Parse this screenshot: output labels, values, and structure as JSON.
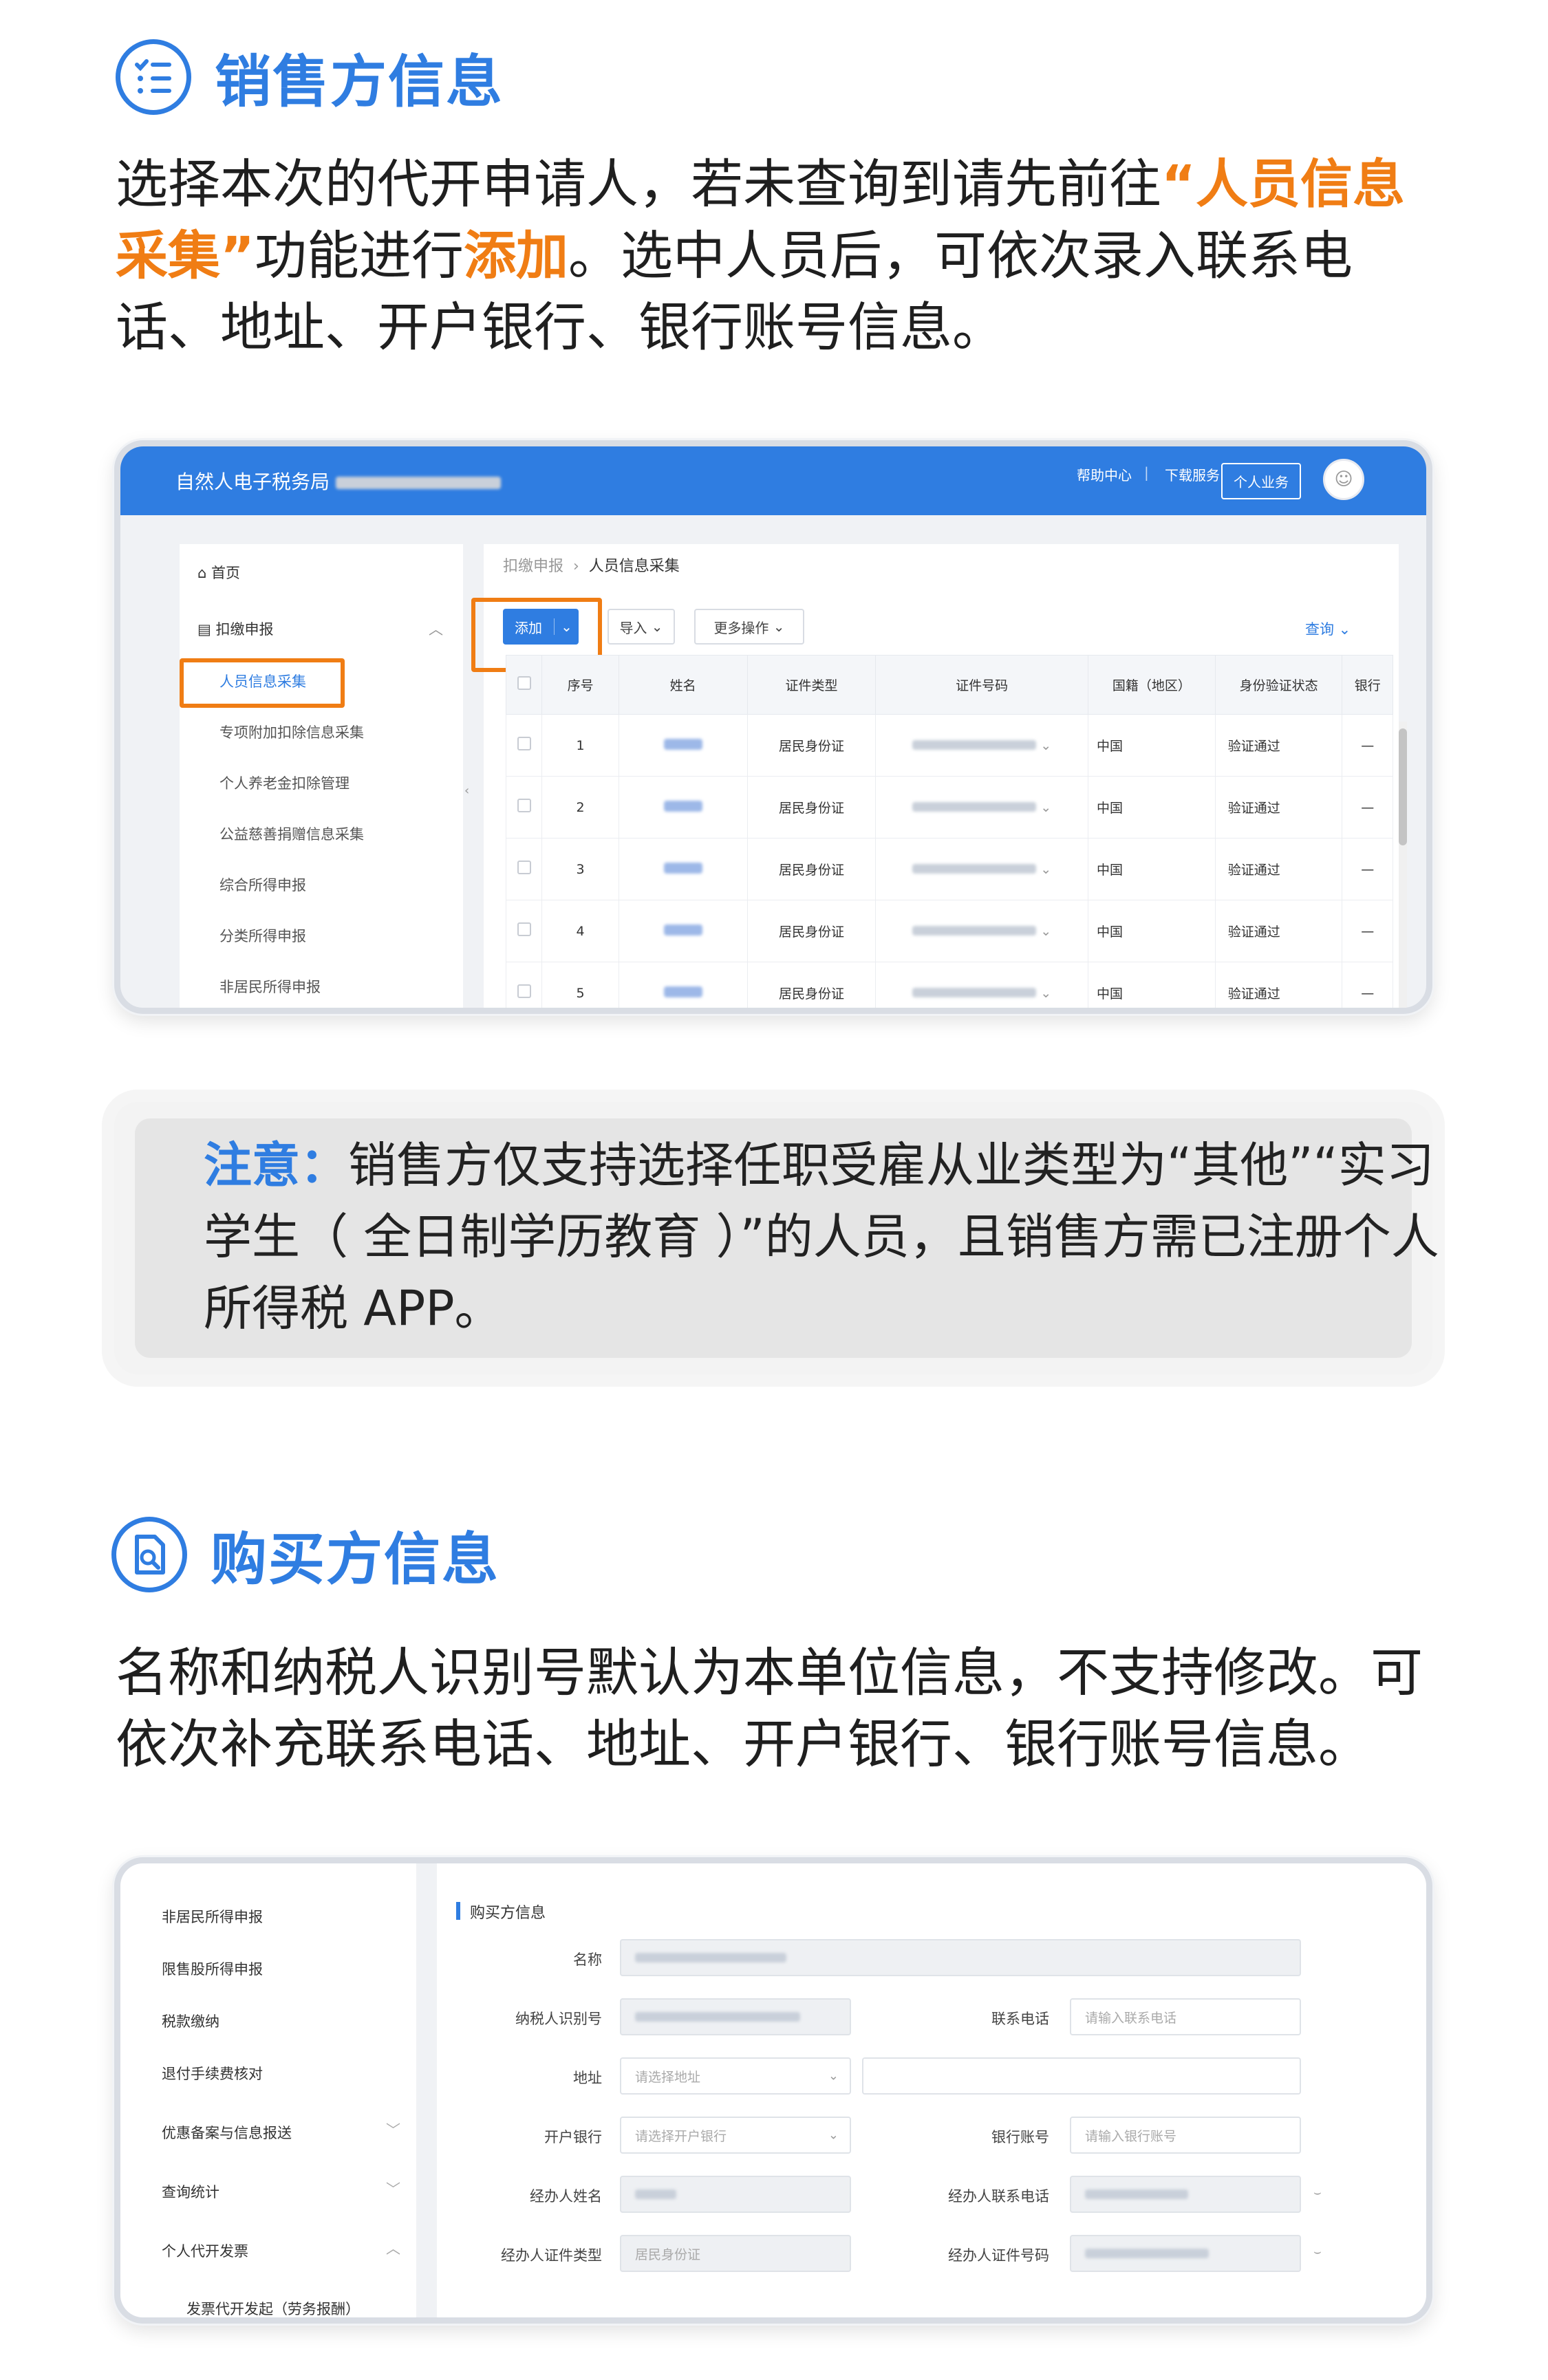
{
  "seller_section": {
    "title": "销售方信息",
    "para_line1": "选择本次的代开申请人，若未查询到请先前往",
    "para_hl1": "“人员信息采集”",
    "para_mid": "功能进行",
    "para_hl2": "添加",
    "para_rest": "。选中人员后，可依次录入联系电话、地址、开户银行、银行账号信息。"
  },
  "screenshot1": {
    "brand": "自然人电子税务局",
    "help": "帮助中心",
    "download": "下载服务",
    "personal_btn": "个人业务",
    "nav": {
      "home": "首页",
      "withholding": "扣缴申报",
      "items": [
        "人员信息采集",
        "专项附加扣除信息采集",
        "个人养老金扣除管理",
        "公益慈善捐赠信息采集",
        "综合所得申报",
        "分类所得申报",
        "非居民所得申报"
      ]
    },
    "breadcrumb_parent": "扣缴申报",
    "breadcrumb_current": "人员信息采集",
    "add_btn": "添加",
    "import_btn": "导入",
    "more_btn": "更多操作",
    "query": "查询",
    "columns": [
      "序号",
      "姓名",
      "证件类型",
      "证件号码",
      "国籍（地区）",
      "身份验证状态",
      "银行"
    ],
    "rows": [
      {
        "no": "1",
        "type": "居民身份证",
        "nation": "中国",
        "status": "验证通过",
        "bank": "—"
      },
      {
        "no": "2",
        "type": "居民身份证",
        "nation": "中国",
        "status": "验证通过",
        "bank": "—"
      },
      {
        "no": "3",
        "type": "居民身份证",
        "nation": "中国",
        "status": "验证通过",
        "bank": "—"
      },
      {
        "no": "4",
        "type": "居民身份证",
        "nation": "中国",
        "status": "验证通过",
        "bank": "—"
      },
      {
        "no": "5",
        "type": "居民身份证",
        "nation": "中国",
        "status": "验证通过",
        "bank": "—"
      }
    ]
  },
  "note": {
    "label": "注意：",
    "text": "销售方仅支持选择任职受雇从业类型为“其他”“实习学生（ 全日制学历教育 ）”的人员，且销售方需已注册个人所得税 APP。"
  },
  "buyer_section": {
    "title": "购买方信息",
    "para": "名称和纳税人识别号默认为本单位信息，不支持修改。可依次补充联系电话、地址、开户银行、银行账号信息。"
  },
  "screenshot2": {
    "nav": [
      "非居民所得申报",
      "限售股所得申报",
      "税款缴纳",
      "退付手续费核对",
      "优惠备案与信息报送",
      "查询统计",
      "个人代开发票",
      "发票代开发起（劳务报酬）"
    ],
    "form_title": "购买方信息",
    "labels": {
      "name": "名称",
      "tax_id": "纳税人识别号",
      "phone": "联系电话",
      "address": "地址",
      "bank": "开户银行",
      "account": "银行账号",
      "agent_name": "经办人姓名",
      "agent_phone": "经办人联系电话",
      "agent_id_type": "经办人证件类型",
      "agent_id_no": "经办人证件号码"
    },
    "placeholders": {
      "phone": "请输入联系电话",
      "address": "请选择地址",
      "bank": "请选择开户银行",
      "account": "请输入银行账号"
    },
    "agent_id_type_value": "居民身份证"
  },
  "colors": {
    "brand_blue": "#2f7de1",
    "accent_orange": "#f07d14"
  }
}
